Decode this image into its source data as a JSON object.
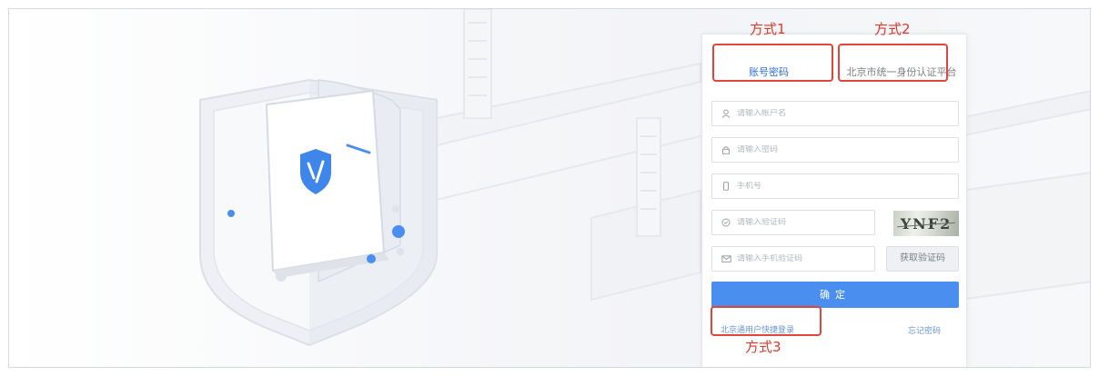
{
  "tabs": {
    "account_password": "账号密码",
    "beijing_identity_platform": "北京市统一身份认证平台"
  },
  "form": {
    "account_placeholder": "请输入帐户名",
    "password_placeholder": "请输入密码",
    "phone_placeholder": "手机号",
    "captcha_placeholder": "请输入验证码",
    "captcha_text": "YNF2",
    "sms_code_placeholder": "请输入手机验证码",
    "get_code_label": "获取验证码",
    "submit_label": "确定"
  },
  "links": {
    "quick_login": "北京通用户快捷登录",
    "forgot_password": "忘记密码"
  },
  "annotations": {
    "method1": "方式1",
    "method2": "方式2",
    "method3": "方式3"
  },
  "icons": [
    "user-icon",
    "lock-icon",
    "phone-icon",
    "captcha-icon",
    "mail-icon",
    "shield-logo-icon"
  ],
  "colors": {
    "primary": "#4a8ff0",
    "link": "#6c95d6",
    "annotation": "#e0443a",
    "active_tab": "#2f6fd6"
  }
}
